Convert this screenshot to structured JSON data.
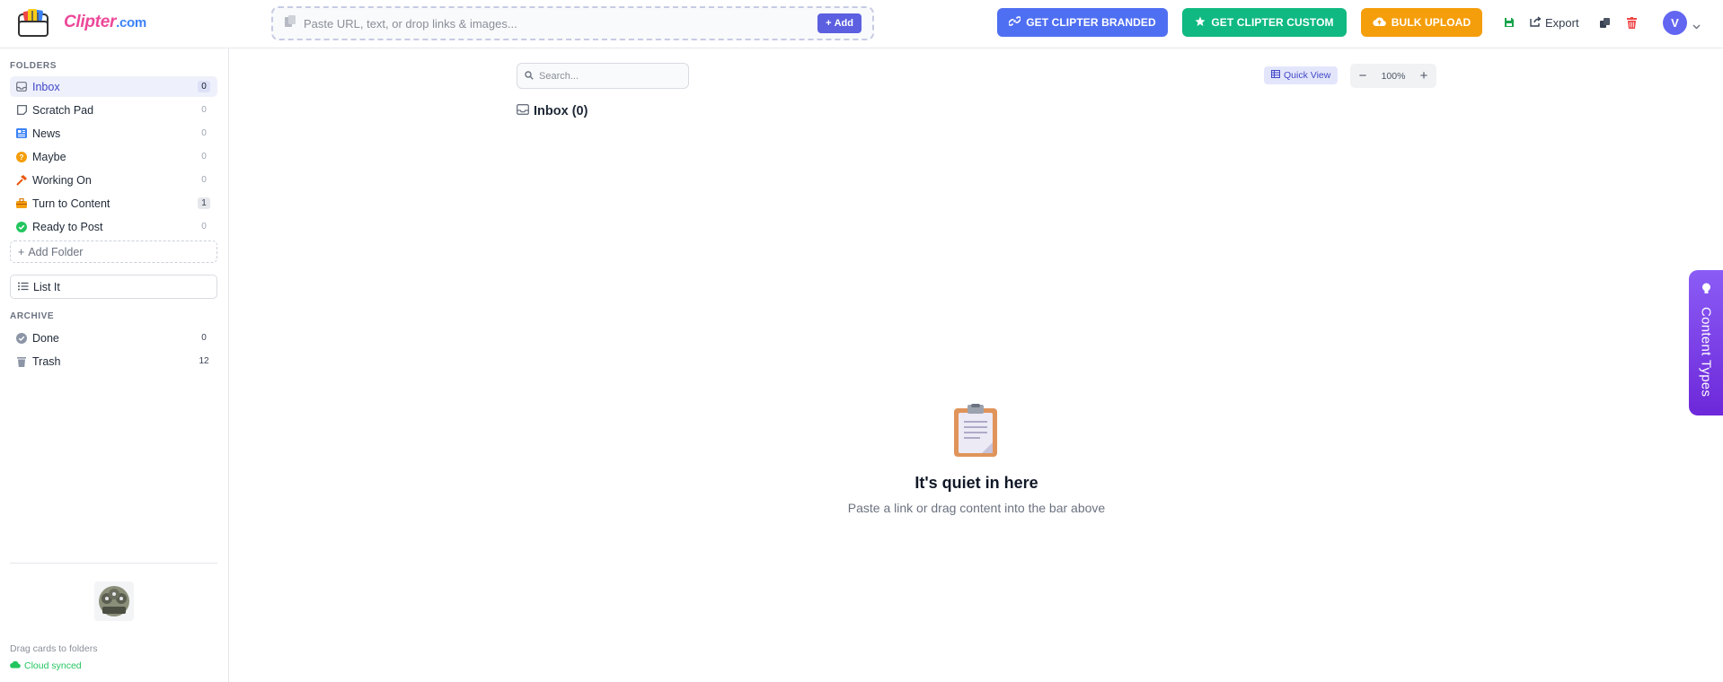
{
  "app": {
    "logo_text": "Clipter",
    "logo_domain": ".com"
  },
  "toolbar": {
    "paste_placeholder": "Paste URL, text, or drop links & images...",
    "add_label": "Add",
    "branded_label": "GET CLIPTER BRANDED",
    "custom_label": "GET CLIPTER CUSTOM",
    "bulk_label": "BULK UPLOAD",
    "export_label": "Export",
    "avatar_initial": "V"
  },
  "sidebar": {
    "folders_title": "FOLDERS",
    "folders": [
      {
        "label": "Inbox",
        "count": "0",
        "icon": "inbox-icon"
      },
      {
        "label": "Scratch Pad",
        "count": "0",
        "icon": "note-icon"
      },
      {
        "label": "News",
        "count": "0",
        "icon": "newspaper-icon"
      },
      {
        "label": "Maybe",
        "count": "0",
        "icon": "question-icon"
      },
      {
        "label": "Working On",
        "count": "0",
        "icon": "hammer-icon"
      },
      {
        "label": "Turn to Content",
        "count": "1",
        "icon": "toolbox-icon"
      },
      {
        "label": "Ready to Post",
        "count": "0",
        "icon": "check-circle-icon"
      }
    ],
    "add_folder_label": "Add Folder",
    "list_it_label": "List It",
    "archive_title": "ARCHIVE",
    "archive": [
      {
        "label": "Done",
        "count": "0",
        "icon": "check-circle-icon"
      },
      {
        "label": "Trash",
        "count": "12",
        "icon": "trash-icon"
      }
    ],
    "drag_hint": "Drag cards to folders",
    "sync_status": "Cloud synced"
  },
  "main": {
    "search_placeholder": "Search...",
    "quick_view_label": "Quick View",
    "zoom_level": "100%",
    "folder_heading": "Inbox (0)",
    "empty_title": "It's quiet in here",
    "empty_subtitle": "Paste a link or drag content into the bar above"
  },
  "side_tab": {
    "label": "Content Types"
  },
  "colors": {
    "accent": "#5b5fe0",
    "branded": "#4f6ff2",
    "custom": "#10b981",
    "bulk": "#f59e0b",
    "content_types": "#7c3aed",
    "synced": "#22c55e"
  }
}
